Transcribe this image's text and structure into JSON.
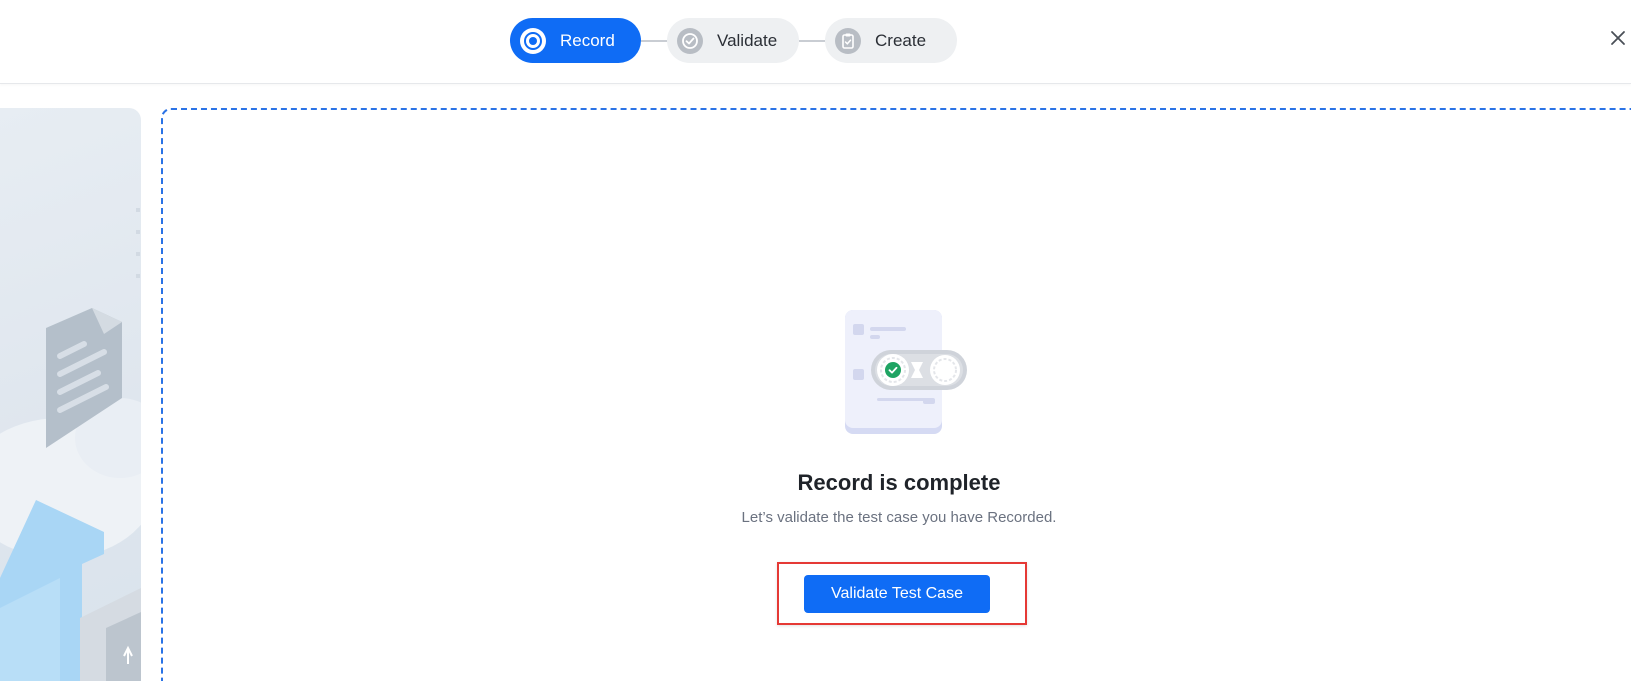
{
  "stepper": {
    "steps": [
      {
        "label": "Record",
        "state": "active",
        "icon": "record-icon"
      },
      {
        "label": "Validate",
        "state": "inactive",
        "icon": "check-circle-icon"
      },
      {
        "label": "Create",
        "state": "inactive",
        "icon": "clipboard-icon"
      }
    ]
  },
  "header": {
    "close_icon": "close-icon"
  },
  "main": {
    "title": "Record is complete",
    "subtitle": "Let’s validate the test case you have Recorded.",
    "cta_label": "Validate Test Case"
  },
  "colors": {
    "accent": "#0f6cf5",
    "step_inactive_bg": "#eef0f2",
    "dashed_border": "#2b73e6",
    "highlight_border": "#e53935",
    "success": "#1fa463"
  }
}
